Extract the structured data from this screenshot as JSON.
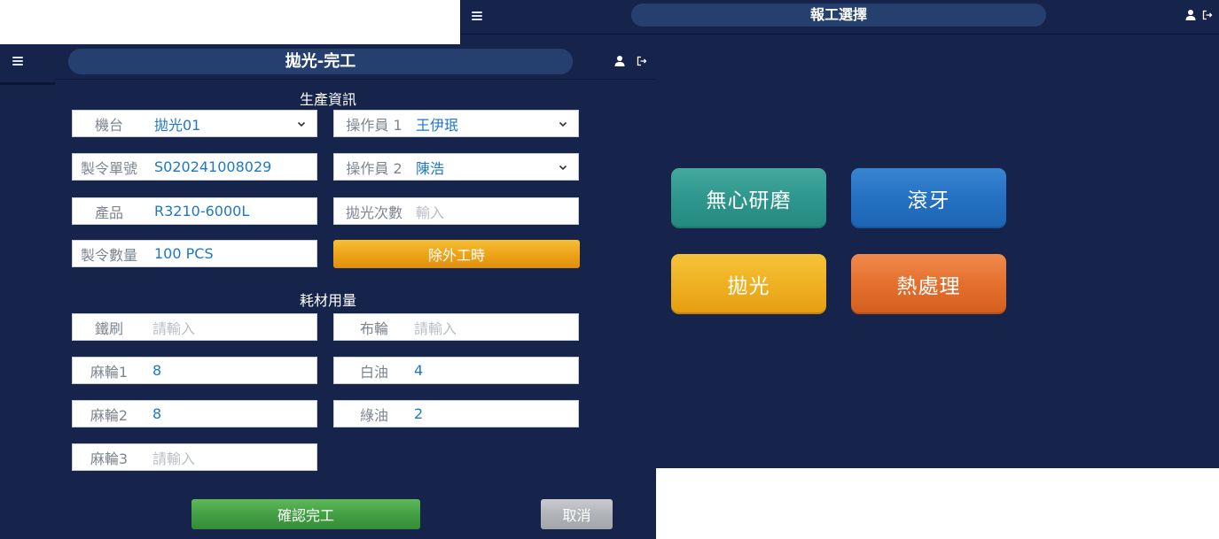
{
  "right_screen": {
    "header": {
      "title": "報工選擇"
    },
    "tiles": [
      {
        "label": "無心研磨",
        "color": "#2e978d"
      },
      {
        "label": "滾牙",
        "color": "#2471c2"
      },
      {
        "label": "拋光",
        "color": "#efb224"
      },
      {
        "label": "熱處理",
        "color": "#e56f2d"
      }
    ]
  },
  "left_screen": {
    "header": {
      "title": "拋光-完工"
    },
    "production": {
      "section_title": "生產資訊",
      "machine": {
        "label": "機台",
        "value": "拋光01"
      },
      "operator1": {
        "label": "操作員 1",
        "value": "王伊珉"
      },
      "order_no": {
        "label": "製令單號",
        "value": "S020241008029"
      },
      "operator2": {
        "label": "操作員 2",
        "value": "陳浩"
      },
      "product": {
        "label": "產品",
        "value": "R3210-6000L"
      },
      "polish_count": {
        "label": "拋光次數",
        "placeholder": "輸入"
      },
      "order_qty": {
        "label": "製令數量",
        "value": "100 PCS"
      },
      "exclude_button": "除外工時"
    },
    "consumables": {
      "section_title": "耗材用量",
      "wire_brush": {
        "label": "鐵刷",
        "placeholder": "請輸入"
      },
      "cloth_wheel": {
        "label": "布輪",
        "placeholder": "請輸入"
      },
      "hemp_wheel1": {
        "label": "麻輪1",
        "value": "8"
      },
      "white_oil": {
        "label": "白油",
        "value": "4"
      },
      "hemp_wheel2": {
        "label": "麻輪2",
        "value": "8"
      },
      "green_oil": {
        "label": "綠油",
        "value": "2"
      },
      "hemp_wheel3": {
        "label": "麻輪3",
        "placeholder": "請輸入"
      }
    },
    "actions": {
      "confirm": "確認完工",
      "cancel": "取消"
    }
  },
  "colors": {
    "background": "#16234a",
    "pill": "#25406e",
    "value_text": "#1e77c8",
    "label_text": "#7d8590"
  }
}
